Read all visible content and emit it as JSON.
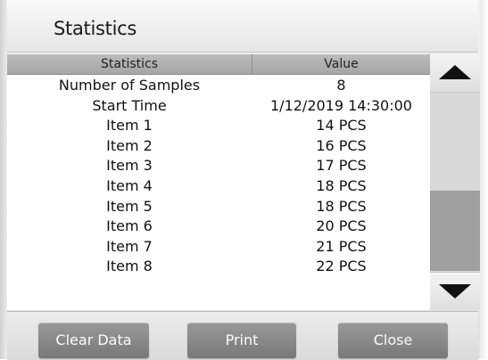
{
  "window": {
    "title": "Statistics"
  },
  "table": {
    "columns": [
      "Statistics",
      "Value"
    ],
    "rows": [
      [
        "Number of Samples",
        "8"
      ],
      [
        "Start Time",
        "1/12/2019 14:30:00"
      ],
      [
        "Item 1",
        "14 PCS"
      ],
      [
        "Item 2",
        "16 PCS"
      ],
      [
        "Item 3",
        "17 PCS"
      ],
      [
        "Item 4",
        "18 PCS"
      ],
      [
        "Item 5",
        "18 PCS"
      ],
      [
        "Item 6",
        "20 PCS"
      ],
      [
        "Item 7",
        "21 PCS"
      ],
      [
        "Item 8",
        "22 PCS"
      ]
    ]
  },
  "scrollbar": {
    "up_icon": "triangle-up-icon",
    "down_icon": "triangle-down-icon",
    "thumb_position_fraction": 0.55,
    "thumb_size_fraction": 0.45
  },
  "footer": {
    "clear_label": "Clear Data",
    "print_label": "Print",
    "close_label": "Close"
  },
  "colors": {
    "button": "#8a8a8a",
    "header": "#b0b0b0",
    "thumb": "#9f9f9f"
  }
}
